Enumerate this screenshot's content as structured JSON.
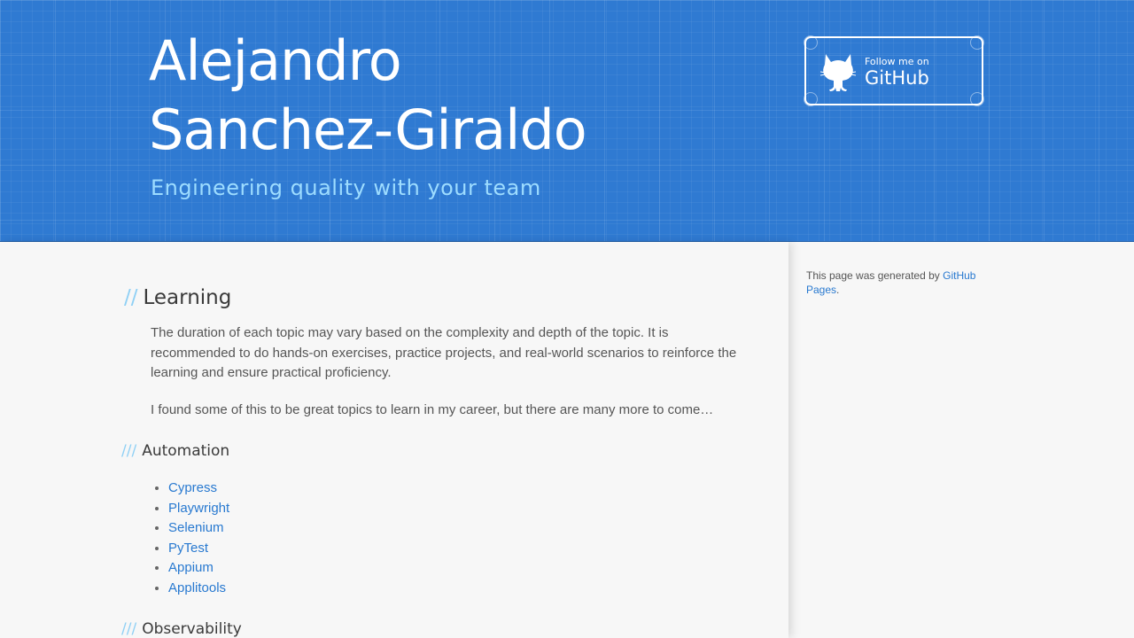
{
  "header": {
    "title": "Alejandro Sanchez-Giraldo",
    "tagline": "Engineering quality with your team",
    "github_banner": {
      "follow_label": "Follow me on",
      "github_label": "GitHub",
      "icon": "octocat-icon"
    }
  },
  "main": {
    "section_title": "Learning",
    "section_prefix": "//",
    "paragraphs": [
      "The duration of each topic may vary based on the complexity and depth of the topic. It is recommended to do hands-on exercises, practice projects, and real-world scenarios to reinforce the learning and ensure practical proficiency.",
      "I found some of this to be great topics to learn in my career, but there are many more to come…"
    ],
    "subsection_prefix": "///",
    "automation": {
      "title": "Automation",
      "items": [
        "Cypress",
        "Playwright",
        "Selenium",
        "PyTest",
        "Appium",
        "Applitools"
      ]
    },
    "observability": {
      "title": "Observability"
    }
  },
  "sidebar": {
    "generated_text": "This page was generated by ",
    "generated_link": "GitHub Pages",
    "generated_suffix": "."
  },
  "colors": {
    "header_bg": "#2f7ad2",
    "tagline": "#9ddcff",
    "link": "#2879d0",
    "slashes": "#8fd0f5"
  }
}
